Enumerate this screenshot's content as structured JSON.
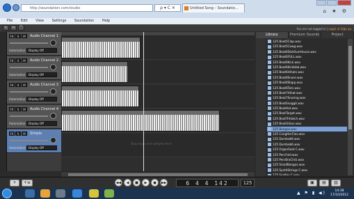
{
  "browser": {
    "url": "http://soundation.com/studio",
    "url_icons": "ρ ▾ C ✕",
    "tab_title": "Untitled Song – Soundatio...",
    "tab_close": "×",
    "top_icons": "⌂ ★ ⚙"
  },
  "menu": [
    "File",
    "Edit",
    "View",
    "Settings",
    "Soundation",
    "Help"
  ],
  "app": {
    "toolbar": [
      "↖",
      "✂",
      "⌒"
    ],
    "login_prefix": "You are not logged in | ",
    "login_link": "Login or Sign up",
    "tracks": [
      {
        "name": "Audio Channel 1",
        "automation": "Display Off"
      },
      {
        "name": "Audio Channel 2",
        "automation": "Display Off"
      },
      {
        "name": "Audio Channel 3",
        "automation": "Display Off"
      },
      {
        "name": "Audio Channel 4",
        "automation": "Display Off"
      },
      {
        "name": "Simple",
        "automation": "Display Off"
      }
    ],
    "track_buttons": [
      "FX",
      "S",
      "M"
    ],
    "automation_label": "Automation",
    "dropzone_text": "Drop loops and samples here",
    "library": {
      "tabs": [
        "Library",
        "Premium Sounds",
        "Project"
      ],
      "files": [
        "125 Beat5Clap.wav",
        "125 Beat5Cowg.wav",
        "125 Beat6DistOverHouse.wav",
        "125 Beat6FULL.wav",
        "125 Beat6Kick.wav",
        "125 Beat6Kickbbb.wav",
        "125 Beat6Hihats.wav",
        "125 Beat6Snare.wav",
        "125 Beat6Slapp.wav",
        "125 Beat6Tom.wav",
        "125 Beat7Hihat.wav",
        "125 Beat7Snaring.wav",
        "125 BeatSnaggit.wav",
        "125 BeatHat.wav",
        "125 BeatTarget.wav",
        "125 BeatTriHatch.wav",
        "125 BeatUrban.wav",
        "125 Bongos.wav",
        "125 CongHerClav.wav",
        "125 Dumbeb6.wav",
        "125 Dumbeb6.wav",
        "125 OrganSeat C.wav",
        "125 PercFold.wav",
        "125 PercBraClick.wav",
        "125 SmallBongos.wav",
        "125 SynthStrings C.wav",
        "125 SynKey C.wav"
      ],
      "highlighted_index": 17
    },
    "transport": {
      "buttons": [
        "◀◀",
        "◀",
        "■",
        "▶",
        "●",
        "▶▶"
      ],
      "position": "6 4 4 142",
      "tempo": "125"
    },
    "bottom_left": [
      "+",
      "+≡"
    ],
    "bottom_right": [
      "▣",
      "▤",
      "▥"
    ]
  },
  "taskbar": {
    "time": "14:38",
    "date": "17/10/2012",
    "tray": "▲ ⚑ ▮ ◀)"
  }
}
